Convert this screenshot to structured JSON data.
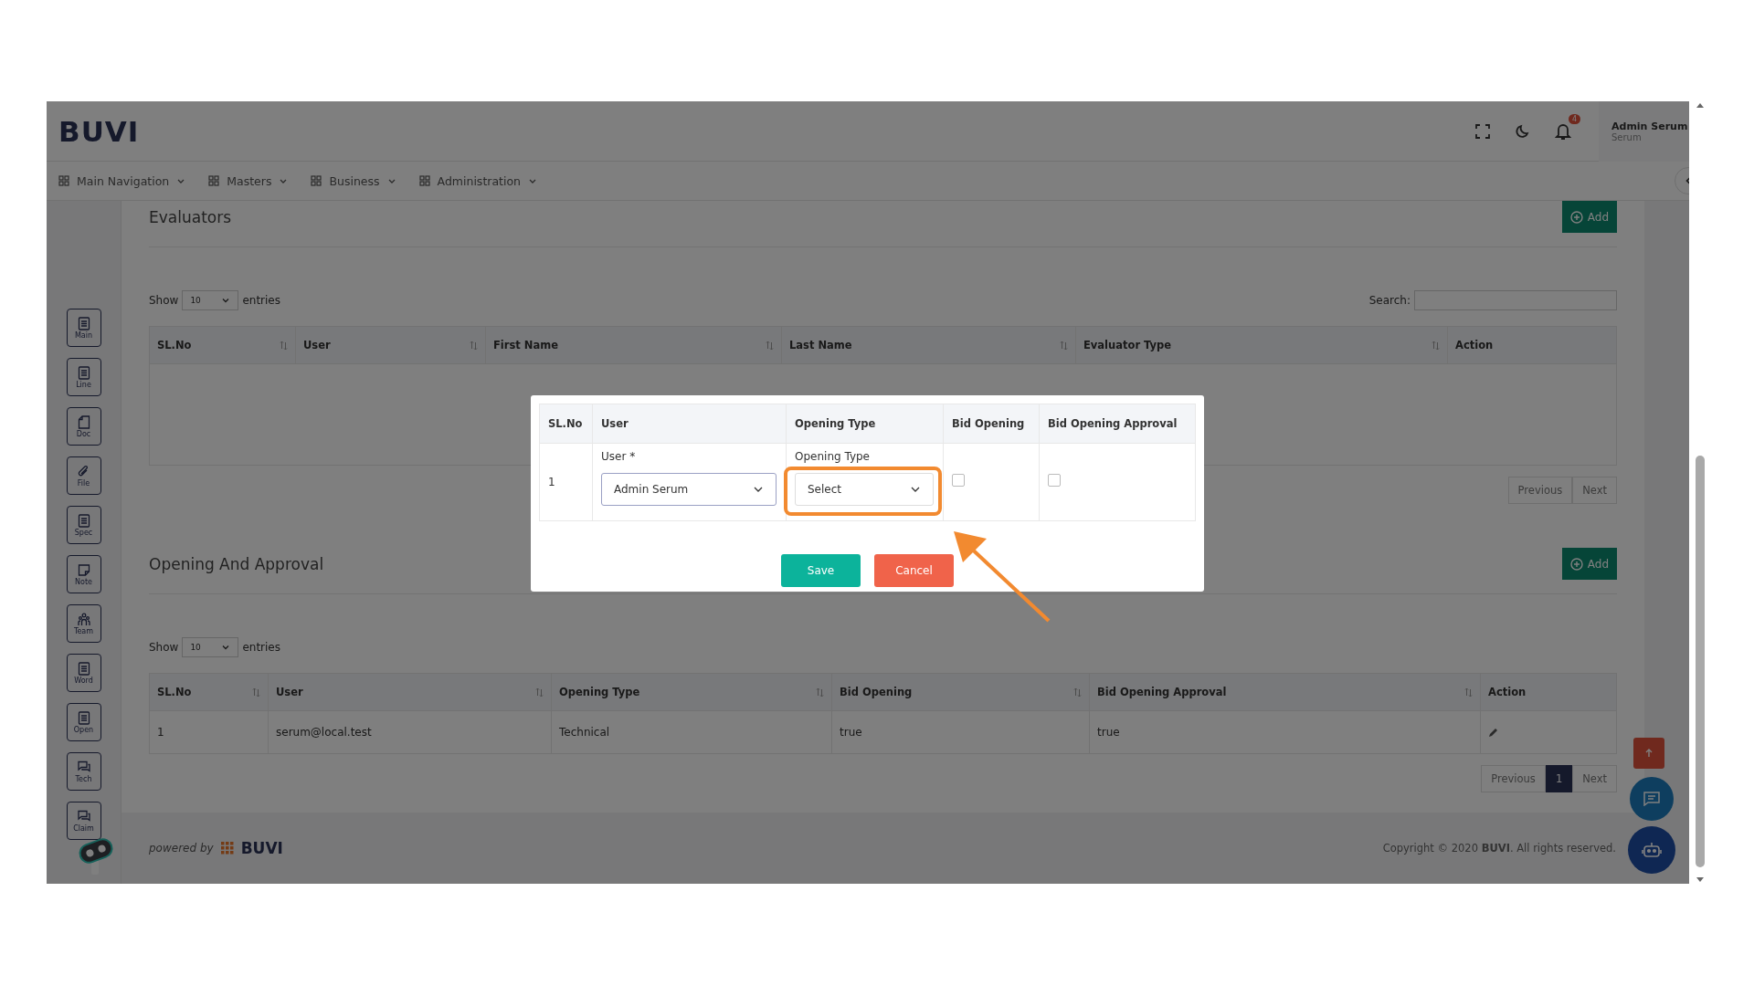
{
  "header": {
    "logo": "BUVI",
    "notification_count": "4",
    "user_name": "Admin Serum",
    "user_role": "Serum"
  },
  "nav": [
    {
      "label": "Main Navigation"
    },
    {
      "label": "Masters"
    },
    {
      "label": "Business"
    },
    {
      "label": "Administration"
    }
  ],
  "sidebar": [
    {
      "label": "Main",
      "kind": "list"
    },
    {
      "label": "Line",
      "kind": "list"
    },
    {
      "label": "Doc",
      "kind": "page"
    },
    {
      "label": "File",
      "kind": "clip"
    },
    {
      "label": "Spec",
      "kind": "list"
    },
    {
      "label": "Note",
      "kind": "note"
    },
    {
      "label": "Team",
      "kind": "team"
    },
    {
      "label": "Word",
      "kind": "list"
    },
    {
      "label": "Open",
      "kind": "list"
    },
    {
      "label": "Tech",
      "kind": "chat"
    },
    {
      "label": "Claim",
      "kind": "chat"
    }
  ],
  "sections": [
    {
      "title": "Evaluators",
      "add_label": "Add",
      "show_label": "Show",
      "page_size": "10",
      "entries_label": "entries",
      "search_label": "Search:",
      "columns": [
        {
          "label": "SL.No",
          "sortable": true
        },
        {
          "label": "User",
          "sortable": true
        },
        {
          "label": "First Name",
          "sortable": true
        },
        {
          "label": "Last Name",
          "sortable": true
        },
        {
          "label": "Evaluator Type",
          "sortable": true
        },
        {
          "label": "Action",
          "sortable": false
        }
      ],
      "pagination": {
        "previous": "Previous",
        "next": "Next"
      }
    },
    {
      "title": "Opening And Approval",
      "add_label": "Add",
      "show_label": "Show",
      "page_size": "10",
      "entries_label": "entries",
      "columns": [
        {
          "label": "SL.No",
          "sortable": true
        },
        {
          "label": "User",
          "sortable": true
        },
        {
          "label": "Opening Type",
          "sortable": true
        },
        {
          "label": "Bid Opening",
          "sortable": true
        },
        {
          "label": "Bid Opening Approval",
          "sortable": true
        },
        {
          "label": "Action",
          "sortable": false
        }
      ],
      "rows": [
        [
          {
            "kind": "text",
            "text": "1"
          },
          {
            "kind": "text",
            "text": "serum@local.test"
          },
          {
            "kind": "text",
            "text": "Technical"
          },
          {
            "kind": "text",
            "text": "true"
          },
          {
            "kind": "text",
            "text": "true"
          },
          {
            "kind": "edit"
          }
        ]
      ],
      "pagination": {
        "previous": "Previous",
        "pages": [
          {
            "label": "1",
            "selected": true
          }
        ],
        "next": "Next"
      }
    }
  ],
  "modal": {
    "columns": [
      "SL.No",
      "User",
      "Opening Type",
      "Bid Opening",
      "Bid Opening Approval"
    ],
    "row": {
      "sl_no": "1",
      "user_label": "User *",
      "user_value": "Admin Serum",
      "type_label": "Opening Type",
      "type_placeholder": "Select",
      "bid_opening_checked": false,
      "bid_approval_checked": false
    },
    "buttons": [
      {
        "label": "Save",
        "kind": "primary"
      },
      {
        "label": "Cancel",
        "kind": "danger"
      }
    ]
  },
  "footer": {
    "powered_by": "powered by",
    "brand": "BUVI",
    "copyright": "Copyright © 2020 **BUVI**. All rights reserved."
  }
}
